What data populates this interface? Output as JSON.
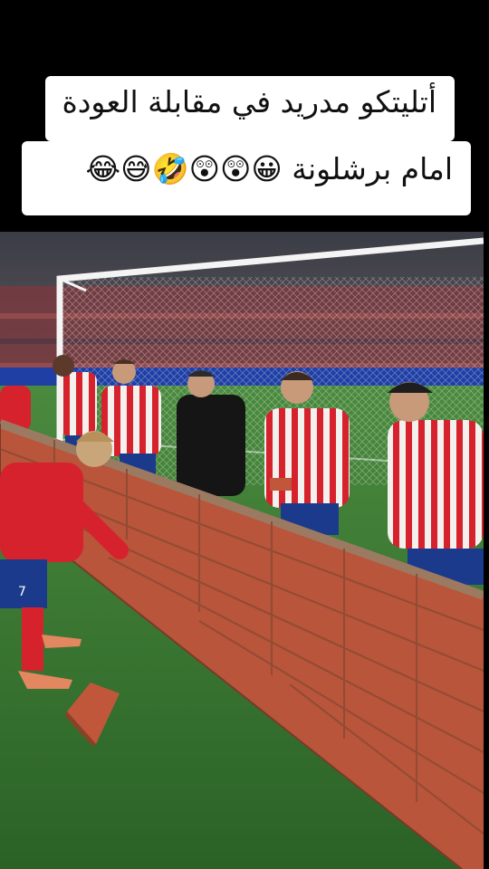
{
  "caption": {
    "line1": "أتليتكو مدريد في مقابلة العودة",
    "line2": "امام برشلونة 😀😲😲🤣😅😂"
  },
  "photo": {
    "jersey_number": "7",
    "colors": {
      "grass": "#2f6d2a",
      "brick": "#c0573a",
      "mortar": "#a87a5a",
      "jersey_red": "#d6222c",
      "jersey_white": "#f3f0ee",
      "shorts_blue": "#1c3a8c"
    }
  }
}
